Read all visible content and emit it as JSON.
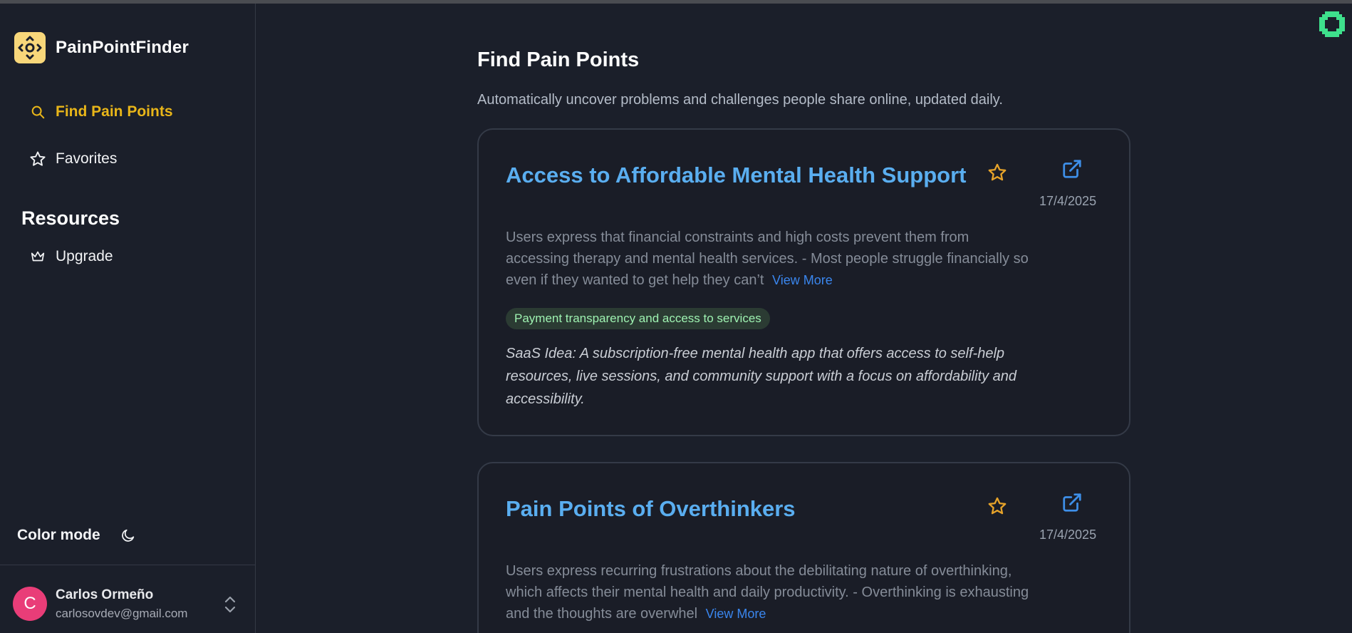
{
  "app": {
    "name": "PainPointFinder"
  },
  "sidebar": {
    "nav": [
      {
        "label": "Find Pain Points",
        "icon": "search-icon",
        "active": true
      },
      {
        "label": "Favorites",
        "icon": "star-icon",
        "active": false
      }
    ],
    "resources_title": "Resources",
    "resources": [
      {
        "label": "Upgrade",
        "icon": "crown-icon"
      }
    ],
    "color_mode": {
      "label": "Color mode",
      "icon": "moon-icon"
    },
    "user": {
      "initial": "C",
      "name": "Carlos Ormeño",
      "email": "carlosovdev@gmail.com"
    }
  },
  "main": {
    "title": "Find Pain Points",
    "subtitle": "Automatically uncover problems and challenges people share online, updated daily.",
    "cards": [
      {
        "title": "Access to Affordable Mental Health Support",
        "date": "17/4/2025",
        "description": "Users express that financial constraints and high costs prevent them from accessing therapy and mental health services. - Most people struggle financially so even if they wanted to get help they can’t",
        "view_more": "View More",
        "tag": "Payment transparency and access to services",
        "idea": "SaaS Idea: A subscription-free mental health app that offers access to self-help resources, live sessions, and community support with a focus on affordability and accessibility."
      },
      {
        "title": "Pain Points of Overthinkers",
        "date": "17/4/2025",
        "description": "Users express recurring frustrations about the debilitating nature of overthinking, which affects their mental health and daily productivity. - Overthinking is exhausting and the thoughts are overwhel",
        "view_more": "View More"
      }
    ]
  },
  "colors": {
    "background": "#1b1f2a",
    "accent": "#e9b619",
    "link": "#5aaef0",
    "tag_bg": "#2b3b33",
    "tag_text": "#9ef2b1",
    "avatar": "#e93d78"
  }
}
